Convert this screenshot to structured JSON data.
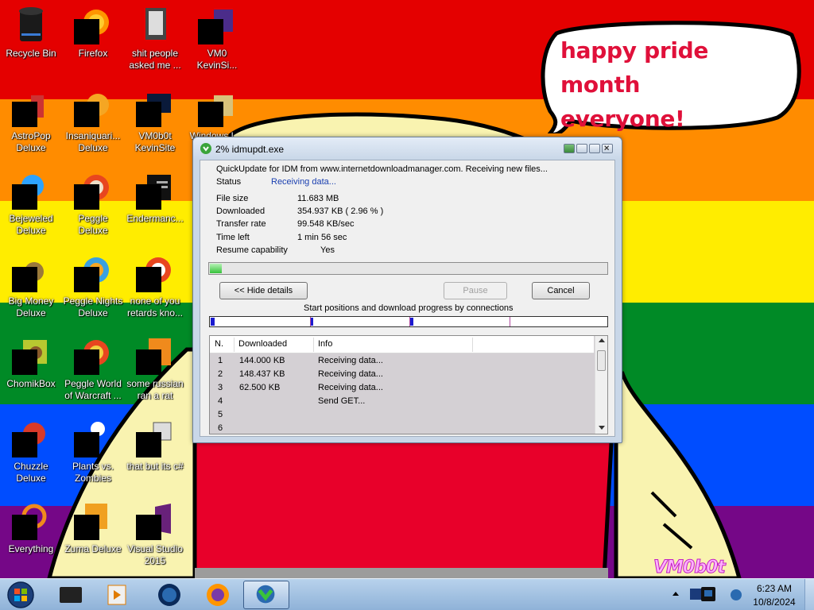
{
  "wallpaper": {
    "stripe_colors": [
      "#e40000",
      "#ff8c00",
      "#ffed00",
      "#008a26",
      "#004dff",
      "#750787"
    ],
    "bubble_text_line1": "happy pride month",
    "bubble_text_line2": "everyone!",
    "signature": "VM0b0t"
  },
  "desktop_icons": [
    {
      "label": "Recycle Bin",
      "icon": "recycle-bin-icon"
    },
    {
      "label": "Firefox",
      "icon": "firefox-icon"
    },
    {
      "label": "shit people asked me ...",
      "icon": "folder-icon"
    },
    {
      "label": "VM0 KevinSi...",
      "icon": "app-icon"
    },
    {
      "label": "AstroPop Deluxe",
      "icon": "astropop-icon"
    },
    {
      "label": "Insaniquari... Deluxe",
      "icon": "insaniquarium-icon"
    },
    {
      "label": "VM0b0t KevinSite",
      "icon": "monitor-icon"
    },
    {
      "label": "Windows L...",
      "icon": "folder-icon"
    },
    {
      "label": "Bejeweled Deluxe",
      "icon": "bejeweled-icon"
    },
    {
      "label": "Peggle Deluxe",
      "icon": "peggle-icon"
    },
    {
      "label": "Endermanc...",
      "icon": "enderman-icon"
    },
    {
      "label": "Big Money Deluxe",
      "icon": "money-bag-icon"
    },
    {
      "label": "Peggle Nights Deluxe",
      "icon": "peggle-nights-icon"
    },
    {
      "label": "none of you retards kno...",
      "icon": "app-icon"
    },
    {
      "label": "ChomikBox",
      "icon": "chomikbox-icon"
    },
    {
      "label": "Peggle World of Warcraft ...",
      "icon": "peggle-wow-icon"
    },
    {
      "label": "some russian ran a rat",
      "icon": "file-icon"
    },
    {
      "label": "Chuzzle Deluxe",
      "icon": "chuzzle-icon"
    },
    {
      "label": "Plants vs. Zombies",
      "icon": "pvz-icon"
    },
    {
      "label": "that but its c#",
      "icon": "window-icon"
    },
    {
      "label": "Everything",
      "icon": "search-icon"
    },
    {
      "label": "Zuma Deluxe",
      "icon": "zuma-icon"
    },
    {
      "label": "Visual Studio 2015",
      "icon": "visual-studio-icon"
    }
  ],
  "idm": {
    "title": "2% idmupdt.exe",
    "description": "QuickUpdate for IDM from www.internetdownloadmanager.com. Receiving new files...",
    "status_label": "Status",
    "status_value": "Receiving data...",
    "file_size_label": "File size",
    "file_size_value": "11.683  MB",
    "downloaded_label": "Downloaded",
    "downloaded_value": "354.937  KB  ( 2.96 % )",
    "transfer_rate_label": "Transfer rate",
    "transfer_rate_value": "99.548  KB/sec",
    "time_left_label": "Time left",
    "time_left_value": "1 min 56 sec",
    "resume_label": "Resume capability",
    "resume_value": "Yes",
    "progress_fraction": 0.0296,
    "hide_details_button": "<< Hide details",
    "pause_button": "Pause",
    "cancel_button": "Cancel",
    "connections_caption": "Start positions and download progress by connections",
    "table_headers": [
      "N.",
      "Downloaded",
      "Info"
    ],
    "rows": [
      {
        "n": "1",
        "downloaded": "144.000  KB",
        "info": "Receiving data..."
      },
      {
        "n": "2",
        "downloaded": "148.437  KB",
        "info": "Receiving data..."
      },
      {
        "n": "3",
        "downloaded": "62.500  KB",
        "info": "Receiving data..."
      },
      {
        "n": "4",
        "downloaded": "",
        "info": "Send GET..."
      },
      {
        "n": "5",
        "downloaded": "",
        "info": ""
      },
      {
        "n": "6",
        "downloaded": "",
        "info": ""
      }
    ]
  },
  "taskbar": {
    "pinned": [
      "start-orb-icon",
      "media-center-icon",
      "media-player-icon",
      "globe-icon",
      "firefox-icon",
      "idm-icon"
    ],
    "time": "6:23 AM",
    "date": "10/8/2024"
  }
}
